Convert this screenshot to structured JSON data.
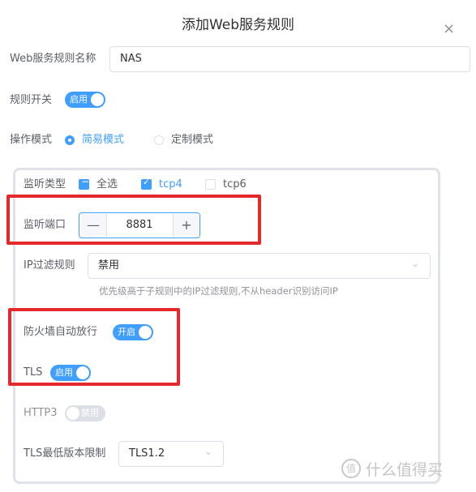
{
  "dialog": {
    "title": "添加Web服务规则",
    "close_glyph": "×"
  },
  "form": {
    "rule_name_label": "Web服务规则名称",
    "rule_name_value": "NAS",
    "rule_switch_label": "规则开关",
    "rule_switch_text": "启用",
    "mode_label": "操作模式",
    "mode_options": [
      "简易模式",
      "定制模式"
    ],
    "mode_selected": "简易模式",
    "listen_type_label": "监听类型",
    "listen_type_options": [
      {
        "label": "全选",
        "checked": true,
        "indeterminate": true
      },
      {
        "label": "tcp4",
        "checked": true
      },
      {
        "label": "tcp6",
        "checked": false
      }
    ],
    "listen_port_label": "监听端口",
    "listen_port_value": "8881",
    "minus_glyph": "—",
    "plus_glyph": "+",
    "ip_filter_label": "IP过滤规则",
    "ip_filter_value": "禁用",
    "ip_filter_hint": "优先级高于子规则中的IP过滤规则,不从header识别访问IP",
    "firewall_label": "防火墙自动放行",
    "firewall_switch_text": "开启",
    "tls_label": "TLS",
    "tls_switch_text": "启用",
    "http3_label": "HTTP3",
    "http3_switch_text": "禁用",
    "tls_min_label": "TLS最低版本限制",
    "tls_min_value": "TLS1.2",
    "select_arrow_glyph": "⌄",
    "check_glyph": "✓",
    "indeterminate_glyph": "−"
  },
  "watermark": {
    "glyph": "值",
    "text": "什么值得买"
  },
  "colors": {
    "accent": "#409eff",
    "highlight_box": "#e4292c"
  }
}
